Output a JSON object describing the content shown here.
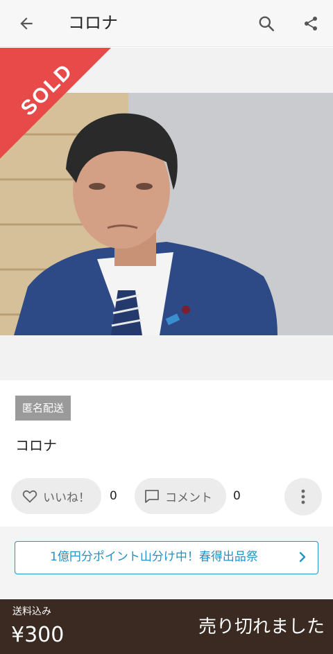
{
  "header": {
    "title": "コロナ",
    "back_icon": "arrow-left-icon",
    "search_icon": "search-icon",
    "share_icon": "share-icon"
  },
  "listing": {
    "sold_badge": "SOLD",
    "photo_alt": "listing photo",
    "tag": "匿名配送",
    "name": "コロナ",
    "like_label": "いいね！",
    "like_count": "0",
    "comment_label": "コメント",
    "comment_count": "0",
    "more_icon": "more-vertical-icon"
  },
  "campaign": {
    "text": "1億円分ポイント山分け中！春得出品祭",
    "chevron_icon": "chevron-right-icon"
  },
  "footer": {
    "shipping_label": "送料込み",
    "price": "¥300",
    "status": "売り切れました"
  },
  "colors": {
    "sold_red": "#e84a4a",
    "accent_blue": "#2193c6",
    "footer_brown": "#3a2a21"
  }
}
